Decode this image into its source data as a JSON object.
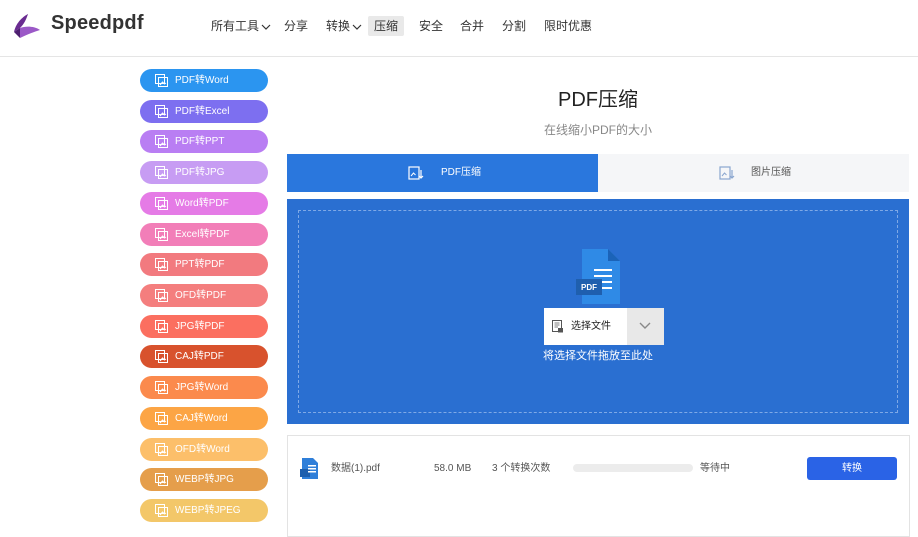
{
  "header": {
    "brand": "Speedpdf",
    "nav": [
      {
        "label": "所有工具",
        "has_dropdown": true
      },
      {
        "label": "分享"
      },
      {
        "label": "转换",
        "has_dropdown": true
      },
      {
        "label": "压缩",
        "active": true
      },
      {
        "label": "安全"
      },
      {
        "label": "合并"
      },
      {
        "label": "分割"
      },
      {
        "label": "限时优惠"
      }
    ]
  },
  "sidebar": {
    "items": [
      {
        "label": "PDF转Word",
        "color": "#2b95f0"
      },
      {
        "label": "PDF转Excel",
        "color": "#7d6ff0"
      },
      {
        "label": "PDF转PPT",
        "color": "#b97ef3"
      },
      {
        "label": "PDF转JPG",
        "color": "#c79cf3"
      },
      {
        "label": "Word转PDF",
        "color": "#e57be6"
      },
      {
        "label": "Excel转PDF",
        "color": "#f27eb8"
      },
      {
        "label": "PPT转PDF",
        "color": "#f27a7f"
      },
      {
        "label": "OFD转PDF",
        "color": "#f47e7e"
      },
      {
        "label": "JPG转PDF",
        "color": "#fb6f60"
      },
      {
        "label": "CAJ转PDF",
        "color": "#d8522d"
      },
      {
        "label": "JPG转Word",
        "color": "#fb8a4d"
      },
      {
        "label": "CAJ转Word",
        "color": "#fca545"
      },
      {
        "label": "OFD转Word",
        "color": "#fcbf6a"
      },
      {
        "label": "WEBP转JPG",
        "color": "#e59e4b"
      },
      {
        "label": "WEBP转JPEG",
        "color": "#f3c769"
      }
    ]
  },
  "main": {
    "title": "PDF压缩",
    "subtitle": "在线缩小PDF的大小",
    "tabs": [
      {
        "label": "PDF压缩",
        "active": true
      },
      {
        "label": "图片压缩",
        "active": false
      }
    ],
    "dropzone": {
      "file_badge": "PDF",
      "select_label": "选择文件",
      "hint": "将选择文件拖放至此处"
    },
    "file": {
      "name": "数据(1).pdf",
      "size": "58.0 MB",
      "conversions": "3 个转换次数",
      "progress": 0,
      "status": "等待中",
      "action_label": "转换"
    }
  },
  "colors": {
    "primary": "#2a77dd",
    "dropzone_bg": "#2a6fd1",
    "convert_button": "#2a63e6",
    "logo": "#7b3fa0"
  }
}
